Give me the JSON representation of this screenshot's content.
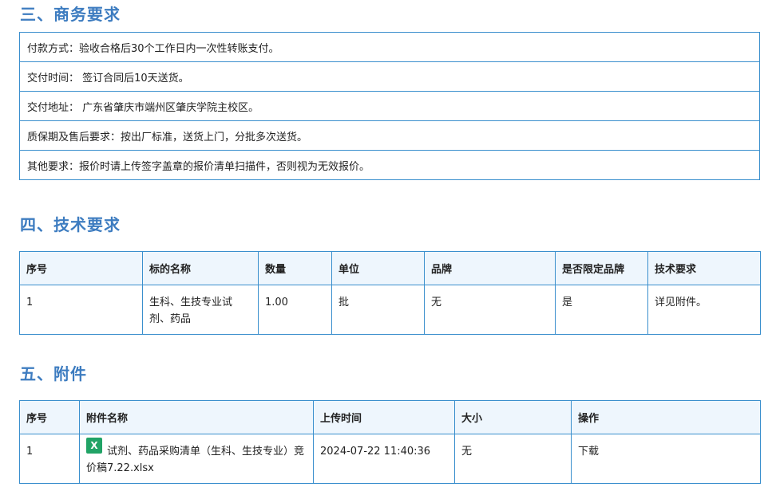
{
  "commercial": {
    "title": "三、商务要求",
    "rows": [
      "付款方式：验收合格后30个工作日内一次性转账支付。",
      "交付时间：  签订合同后10天送货。",
      "交付地址：  广东省肇庆市端州区肇庆学院主校区。",
      "质保期及售后要求：按出厂标准，送货上门，分批多次送货。",
      "其他要求：报价时请上传签字盖章的报价清单扫描件，否则视为无效报价。"
    ]
  },
  "technical": {
    "title": "四、技术要求",
    "headers": [
      "序号",
      "标的名称",
      "数量",
      "单位",
      "品牌",
      "是否限定品牌",
      "技术要求"
    ],
    "rows": [
      [
        "1",
        "生科、生技专业试剂、药品",
        "1.00",
        "批",
        "无",
        "是",
        "详见附件。"
      ]
    ]
  },
  "attachments": {
    "title": "五、附件",
    "headers": [
      "序号",
      "附件名称",
      "上传时间",
      "大小",
      "操作"
    ],
    "rows": [
      {
        "index": "1",
        "icon": "excel-file-icon",
        "icon_letter": "X",
        "name": "试剂、药品采购清单（生科、生技专业）竞价稿7.22.xlsx",
        "time": "2024-07-22 11:40:36",
        "size": "无",
        "action": "下载"
      }
    ]
  }
}
